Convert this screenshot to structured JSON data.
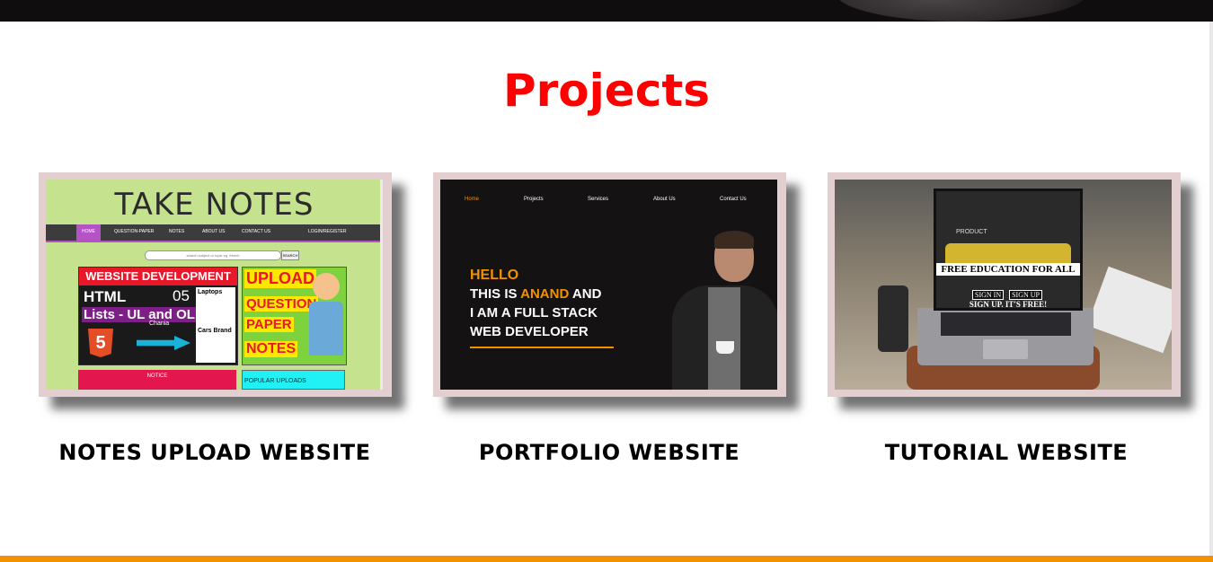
{
  "section": {
    "title": "Projects"
  },
  "projects": [
    {
      "title": "NOTES UPLOAD WEBSITE",
      "preview": {
        "brand": "TAKE NOTES",
        "nav": [
          "HOME",
          "QUESTION-PAPER",
          "NOTES",
          "ABOUT US",
          "CONTACT US",
          "LOGIN/REGISTER"
        ],
        "search_placeholder": "search subject or topic eg. french",
        "search_button": "SEARCH",
        "banner_title": "WEBSITE DEVELOPMENT",
        "banner_html": "HTML",
        "banner_number": "05",
        "banner_lists": "Lists - UL and OL",
        "banner_chania": "Chania",
        "side_heading_1": "Laptops",
        "side_heading_2": "Cars Brand",
        "upload_lines": [
          "UPLOAD",
          "QUESTION",
          "PAPER",
          "NOTES"
        ],
        "notice": "NOTICE",
        "popular": "POPULAR UPLOADS"
      }
    },
    {
      "title": "PORTFOLIO WEBSITE",
      "preview": {
        "nav": [
          "Home",
          "Projects",
          "Services",
          "About Us",
          "Contact Us"
        ],
        "hello": "HELLO",
        "line1_a": "THIS IS ",
        "line1_name": "ANAND",
        "line1_b": " AND",
        "line2": "I AM A FULL STACK",
        "line3": "WEB DEVELOPER"
      }
    },
    {
      "title": "TUTORIAL WEBSITE",
      "preview": {
        "product": "PRODUCT",
        "headline": "FREE EDUCATION FOR ALL",
        "sign_in": "SIGN IN",
        "sign_up": "SIGN UP",
        "tagline": "SIGN UP. IT'S FREE!"
      }
    }
  ],
  "colors": {
    "title": "#ff0000",
    "accent": "#f39200",
    "card_frame": "#e3cfcf",
    "top_bar": "#0f0d0e"
  }
}
